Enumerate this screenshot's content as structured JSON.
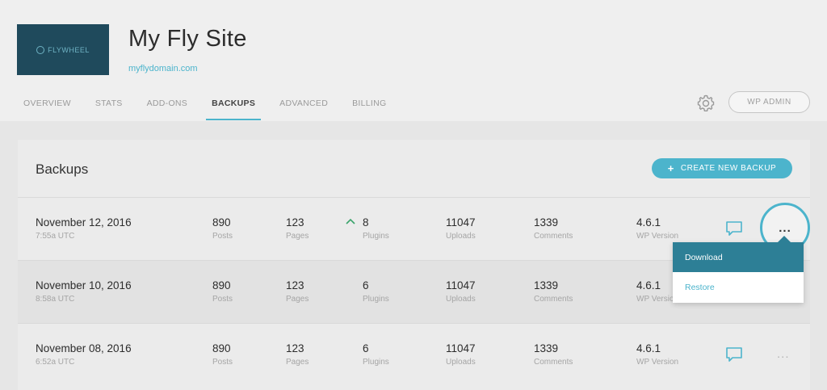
{
  "site": {
    "logo_text": "FLYWHEEL",
    "title": "My Fly Site",
    "url": "myflydomain.com"
  },
  "tabs": [
    {
      "label": "OVERVIEW",
      "active": false
    },
    {
      "label": "STATS",
      "active": false
    },
    {
      "label": "ADD-ONS",
      "active": false
    },
    {
      "label": "BACKUPS",
      "active": true
    },
    {
      "label": "ADVANCED",
      "active": false
    },
    {
      "label": "BILLING",
      "active": false
    }
  ],
  "header_actions": {
    "settings_icon": "gear-icon",
    "wp_admin_label": "WP ADMIN"
  },
  "backups": {
    "title": "Backups",
    "create_label": "CREATE NEW BACKUP",
    "create_icon": "+",
    "labels": {
      "posts": "Posts",
      "pages": "Pages",
      "plugins": "Plugins",
      "uploads": "Uploads",
      "comments": "Comments",
      "wp_version": "WP Version"
    },
    "rows": [
      {
        "date": "November 12, 2016",
        "time": "7:55a UTC",
        "posts": "890",
        "pages": "123",
        "plugins": "8",
        "plugins_trend": "up",
        "uploads": "11047",
        "comments": "1339",
        "wp_version": "4.6.1",
        "more": "..."
      },
      {
        "date": "November 10, 2016",
        "time": "8:58a UTC",
        "posts": "890",
        "pages": "123",
        "plugins": "6",
        "uploads": "11047",
        "comments": "1339",
        "wp_version": "4.6.1"
      },
      {
        "date": "November 08, 2016",
        "time": "6:52a UTC",
        "posts": "890",
        "pages": "123",
        "plugins": "6",
        "uploads": "11047",
        "comments": "1339",
        "wp_version": "4.6.1",
        "more": "..."
      }
    ]
  },
  "dropdown": {
    "items": [
      {
        "label": "Download",
        "active": true
      },
      {
        "label": "Restore",
        "active": false
      }
    ]
  },
  "colors": {
    "accent": "#4cb4cc",
    "accent_dark": "#2d7f96",
    "logo_bg": "#1f4a5c",
    "trend_up": "#3aa36b"
  }
}
